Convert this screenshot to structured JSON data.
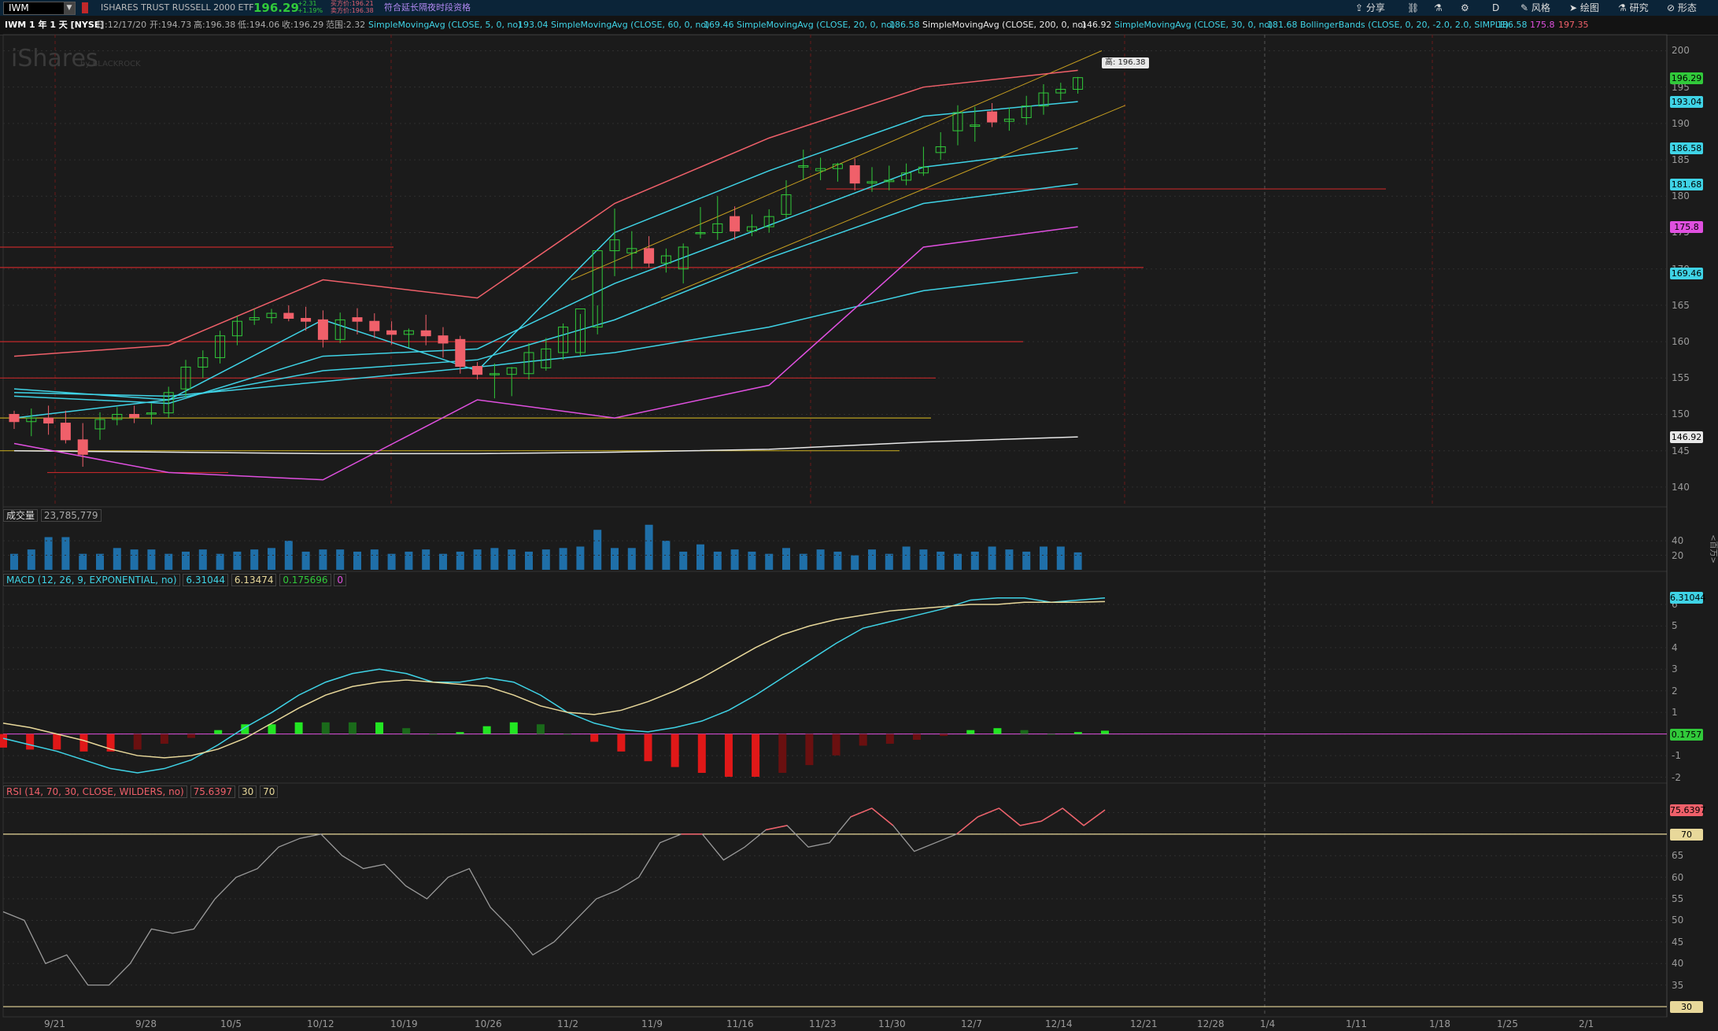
{
  "topbar": {
    "symbol": "IWM",
    "company": "ISHARES TRUST RUSSELL 2000 ETF",
    "price": "196.29",
    "change": "+2.31",
    "change_pct": "+1.19%",
    "bid": "买方价:196.21",
    "ask": "卖方价:196.38",
    "extended_notice": "符合延长隔夜时段资格",
    "buttons": [
      "分享",
      "风格",
      "绘图",
      "研究",
      "形态"
    ],
    "period_button": "D"
  },
  "legend": {
    "title": "IWM 1 年 1 天 [NYSE]",
    "date": "日:12/17/20",
    "open": "开:194.73",
    "high": "高:196.38",
    "low": "低:194.06",
    "close": "收:196.29",
    "range": "范围:2.32",
    "studies": [
      {
        "label": "SimpleMovingAvg (CLOSE, 5, 0, no)",
        "value": "193.04",
        "color": "#3fd3e6"
      },
      {
        "label": "SimpleMovingAvg (CLOSE, 60, 0, no)",
        "value": "169.46",
        "color": "#3fd3e6"
      },
      {
        "label": "SimpleMovingAvg (CLOSE, 20, 0, no)",
        "value": "186.58",
        "color": "#3fd3e6"
      },
      {
        "label": "SimpleMovingAvg (CLOSE, 200, 0, no)",
        "value": "146.92",
        "color": "#e8e8e8"
      },
      {
        "label": "SimpleMovingAvg (CLOSE, 30, 0, no)",
        "value": "181.68",
        "color": "#3fd3e6"
      }
    ],
    "bollinger": {
      "label": "BollingerBands (CLOSE, 0, 20, -2.0, 2.0, SIMPLE)",
      "mid": "186.58",
      "lower": "175.8",
      "upper": "197.35"
    }
  },
  "price_panel": {
    "watermark": "iShares",
    "watermark_sub": "by BLACKROCK",
    "high_callout": "高: 196.38",
    "axis_ticks": [
      "200",
      "195",
      "190",
      "185",
      "180",
      "175",
      "170",
      "165",
      "160",
      "155",
      "150",
      "145",
      "140"
    ],
    "badges": [
      {
        "value": "196.29",
        "color": "#31c93a"
      },
      {
        "value": "193.04",
        "color": "#3fd3e6"
      },
      {
        "value": "186.58",
        "color": "#3fd3e6"
      },
      {
        "value": "181.68",
        "color": "#3fd3e6"
      },
      {
        "value": "175.8",
        "color": "#e050e0"
      },
      {
        "value": "169.46",
        "color": "#3fd3e6"
      },
      {
        "value": "146.92",
        "color": "#e8e8e8"
      }
    ]
  },
  "volume_panel": {
    "label": "成交量",
    "value": "23,785,779",
    "axis_ticks": [
      "40",
      "20"
    ],
    "axis_unit": "<百万>"
  },
  "macd_panel": {
    "label": "MACD (12, 26, 9, EXPONENTIAL, no)",
    "value": "6.31044",
    "avg": "6.13474",
    "diff": "0.175696",
    "zero": "0",
    "axis_ticks": [
      "6",
      "5",
      "4",
      "3",
      "2",
      "1",
      "0",
      "-1",
      "-2"
    ],
    "badge_value": "6.31044",
    "badge_diff": "0.1757"
  },
  "rsi_panel": {
    "label": "RSI (14, 70, 30, CLOSE, WILDERS, no)",
    "value": "75.6397",
    "oversold": "30",
    "overbought": "70",
    "axis_ticks": [
      "75",
      "70",
      "65",
      "60",
      "55",
      "50",
      "45",
      "40",
      "35",
      "30"
    ],
    "badge_value": "75.6397"
  },
  "x_axis": [
    "9/21",
    "9/28",
    "10/5",
    "10/12",
    "10/19",
    "10/26",
    "11/2",
    "11/9",
    "11/16",
    "11/23",
    "11/30",
    "12/7",
    "12/14",
    "12/21",
    "12/28",
    "1/4",
    "1/11",
    "1/18",
    "1/25",
    "2/1"
  ],
  "colors": {
    "up": "#31c93a",
    "down": "#f0606a",
    "macd_line": "#3fd3e6",
    "macd_avg": "#e8d89a",
    "rsi": "#b0b0b0",
    "volume": "#1f6fa8"
  },
  "chart_data": [
    {
      "type": "candlestick",
      "title": "IWM 1 年 1 天 [NYSE]",
      "x": [
        "9/21",
        "9/22",
        "9/23",
        "9/24",
        "9/25",
        "9/28",
        "9/29",
        "9/30",
        "10/1",
        "10/2",
        "10/5",
        "10/6",
        "10/7",
        "10/8",
        "10/9",
        "10/12",
        "10/13",
        "10/14",
        "10/15",
        "10/16",
        "10/19",
        "10/20",
        "10/21",
        "10/22",
        "10/23",
        "10/26",
        "10/27",
        "10/28",
        "10/29",
        "10/30",
        "11/2",
        "11/3",
        "11/4",
        "11/5",
        "11/6",
        "11/9",
        "11/10",
        "11/11",
        "11/12",
        "11/13",
        "11/16",
        "11/17",
        "11/18",
        "11/19",
        "11/20",
        "11/23",
        "11/24",
        "11/25",
        "11/27",
        "11/30",
        "12/1",
        "12/2",
        "12/3",
        "12/4",
        "12/7",
        "12/8",
        "12/9",
        "12/10",
        "12/11",
        "12/14",
        "12/15",
        "12/16",
        "12/17"
      ],
      "open": [
        150.0,
        149.0,
        149.5,
        148.8,
        146.5,
        148.0,
        149.3,
        150.0,
        150.2,
        150.2,
        153.5,
        156.5,
        157.8,
        160.8,
        163.0,
        163.3,
        163.9,
        163.2,
        163.0,
        160.3,
        163.3,
        162.8,
        161.5,
        161.0,
        161.5,
        160.8,
        160.3,
        156.6,
        155.5,
        155.5,
        155.6,
        156.4,
        158.5,
        158.5,
        162.0,
        172.5,
        172.2,
        172.8,
        170.8,
        170.0,
        175.0,
        175.0,
        177.2,
        175.2,
        175.8,
        177.5,
        184.0,
        183.5,
        183.8,
        184.2,
        181.8,
        182.0,
        182.2,
        183.2,
        186.0,
        189.0,
        189.6,
        191.6,
        190.3,
        190.8,
        192.4,
        194.2,
        194.7
      ],
      "high": [
        150.5,
        150.8,
        151.2,
        150.5,
        148.8,
        150.3,
        151.0,
        151.2,
        151.5,
        153.8,
        157.5,
        158.8,
        161.5,
        163.5,
        164.5,
        164.5,
        165.0,
        164.8,
        164.3,
        164.0,
        164.6,
        163.9,
        162.8,
        161.8,
        163.7,
        162.0,
        160.8,
        157.2,
        157.0,
        156.5,
        159.8,
        160.5,
        162.5,
        163.8,
        165.0,
        178.3,
        175.2,
        174.5,
        172.8,
        173.5,
        178.5,
        180.0,
        178.6,
        177.5,
        178.2,
        182.2,
        186.4,
        185.3,
        184.6,
        185.2,
        184.0,
        184.2,
        184.5,
        186.8,
        188.8,
        192.5,
        192.3,
        192.8,
        192.2,
        193.8,
        195.4,
        195.6,
        196.4
      ],
      "low": [
        148.0,
        147.0,
        147.2,
        146.0,
        142.8,
        146.5,
        148.5,
        148.8,
        148.6,
        149.5,
        152.4,
        155.0,
        157.0,
        159.5,
        162.3,
        162.5,
        162.8,
        161.5,
        159.2,
        159.8,
        161.0,
        160.5,
        159.6,
        159.2,
        159.5,
        157.8,
        155.6,
        154.8,
        152.2,
        152.5,
        154.8,
        156.0,
        157.5,
        158.0,
        161.0,
        169.0,
        170.0,
        170.2,
        169.5,
        168.0,
        174.2,
        174.0,
        174.0,
        174.5,
        175.0,
        177.0,
        182.3,
        182.2,
        182.0,
        180.8,
        180.6,
        180.8,
        181.5,
        182.8,
        185.0,
        187.0,
        187.5,
        189.5,
        189.0,
        189.8,
        191.2,
        193.2,
        194.1
      ],
      "close": [
        149.0,
        149.5,
        148.8,
        146.5,
        144.5,
        149.3,
        150.0,
        149.6,
        150.2,
        153.0,
        156.5,
        157.8,
        160.8,
        162.8,
        163.3,
        163.9,
        163.2,
        162.8,
        160.3,
        163.0,
        162.8,
        161.5,
        161.0,
        161.5,
        160.8,
        159.8,
        156.6,
        155.5,
        155.6,
        156.4,
        158.5,
        159.0,
        162.0,
        164.5,
        172.5,
        174.0,
        172.8,
        170.8,
        171.8,
        173.0,
        175.0,
        176.2,
        175.2,
        175.8,
        177.2,
        180.2,
        184.2,
        183.8,
        184.4,
        181.8,
        182.0,
        182.2,
        183.2,
        184.0,
        186.8,
        191.5,
        189.8,
        190.2,
        190.6,
        192.4,
        194.2,
        194.7,
        196.3
      ]
    },
    {
      "type": "line",
      "title": "Moving averages and Bollinger Bands",
      "x": [
        "9/21",
        "10/5",
        "10/19",
        "11/2",
        "11/16",
        "11/30",
        "12/14",
        "12/17"
      ],
      "series": [
        {
          "name": "SimpleMovingAvg (CLOSE, 5, 0, no)",
          "values": [
            149.5,
            152.0,
            163.0,
            156.0,
            175.0,
            183.5,
            191.0,
            193.0
          ]
        },
        {
          "name": "SimpleMovingAvg (CLOSE, 20, 0, no)",
          "values": [
            152.5,
            151.5,
            158.0,
            159.0,
            168.0,
            176.0,
            184.0,
            186.6
          ]
        },
        {
          "name": "SimpleMovingAvg (CLOSE, 30, 0, no)",
          "values": [
            153.5,
            152.0,
            156.0,
            157.5,
            163.0,
            171.5,
            179.0,
            181.7
          ]
        },
        {
          "name": "SimpleMovingAvg (CLOSE, 60, 0, no)",
          "values": [
            153.0,
            152.5,
            154.5,
            156.5,
            158.5,
            162.0,
            167.0,
            169.5
          ]
        },
        {
          "name": "SimpleMovingAvg (CLOSE, 200, 0, no)",
          "values": [
            145.0,
            144.8,
            144.6,
            144.6,
            144.8,
            145.2,
            146.2,
            146.9
          ]
        },
        {
          "name": "BollingerBands upper",
          "values": [
            158.0,
            159.5,
            168.5,
            166.0,
            179.0,
            188.0,
            195.0,
            197.3
          ]
        },
        {
          "name": "BollingerBands lower",
          "values": [
            146.0,
            142.0,
            141.0,
            152.0,
            149.5,
            154.0,
            173.0,
            175.8
          ]
        }
      ]
    },
    {
      "type": "bar",
      "title": "成交量",
      "ylabel": "<百万>",
      "values": [
        22,
        28,
        45,
        45,
        22,
        22,
        30,
        28,
        28,
        22,
        25,
        28,
        22,
        25,
        28,
        30,
        40,
        25,
        28,
        28,
        25,
        28,
        22,
        25,
        28,
        22,
        25,
        28,
        30,
        28,
        25,
        28,
        30,
        32,
        55,
        30,
        30,
        62,
        40,
        25,
        35,
        25,
        28,
        25,
        22,
        30,
        22,
        28,
        25,
        20,
        28,
        22,
        32,
        28,
        25,
        22,
        25,
        32,
        28,
        25,
        32,
        32,
        24
      ]
    },
    {
      "type": "line",
      "title": "MACD (12, 26, 9, EXPONENTIAL, no)",
      "series": [
        {
          "name": "Value",
          "values": [
            -0.2,
            -0.5,
            -0.8,
            -1.2,
            -1.6,
            -1.8,
            -1.6,
            -1.2,
            -0.5,
            0.3,
            1.0,
            1.8,
            2.4,
            2.8,
            3.0,
            2.8,
            2.4,
            2.4,
            2.6,
            2.4,
            1.8,
            1.0,
            0.5,
            0.2,
            0.1,
            0.3,
            0.6,
            1.1,
            1.8,
            2.6,
            3.4,
            4.2,
            4.9,
            5.2,
            5.5,
            5.8,
            6.2,
            6.3,
            6.3,
            6.1,
            6.2,
            6.3
          ]
        },
        {
          "name": "Avg",
          "values": [
            0.5,
            0.3,
            0.0,
            -0.3,
            -0.7,
            -1.0,
            -1.1,
            -1.0,
            -0.7,
            -0.2,
            0.5,
            1.2,
            1.8,
            2.2,
            2.4,
            2.5,
            2.4,
            2.3,
            2.2,
            1.8,
            1.3,
            1.0,
            0.9,
            1.1,
            1.5,
            2.0,
            2.6,
            3.3,
            4.0,
            4.6,
            5.0,
            5.3,
            5.5,
            5.7,
            5.8,
            5.9,
            6.0,
            6.0,
            6.1,
            6.1,
            6.1,
            6.13
          ]
        }
      ],
      "ylim": [
        -2,
        6.5
      ]
    },
    {
      "type": "line",
      "title": "RSI (14, 70, 30, CLOSE, WILDERS, no)",
      "series": [
        {
          "name": "RSI",
          "values": [
            52,
            50,
            40,
            42,
            35,
            35,
            40,
            48,
            47,
            48,
            55,
            60,
            62,
            67,
            69,
            70,
            65,
            62,
            63,
            58,
            55,
            60,
            62,
            53,
            48,
            42,
            45,
            50,
            55,
            57,
            60,
            68,
            70,
            70,
            64,
            67,
            71,
            72,
            67,
            68,
            74,
            76,
            72,
            66,
            68,
            70,
            74,
            76,
            72,
            73,
            76,
            72,
            75.6
          ]
        }
      ],
      "ylim": [
        30,
        76
      ]
    }
  ]
}
